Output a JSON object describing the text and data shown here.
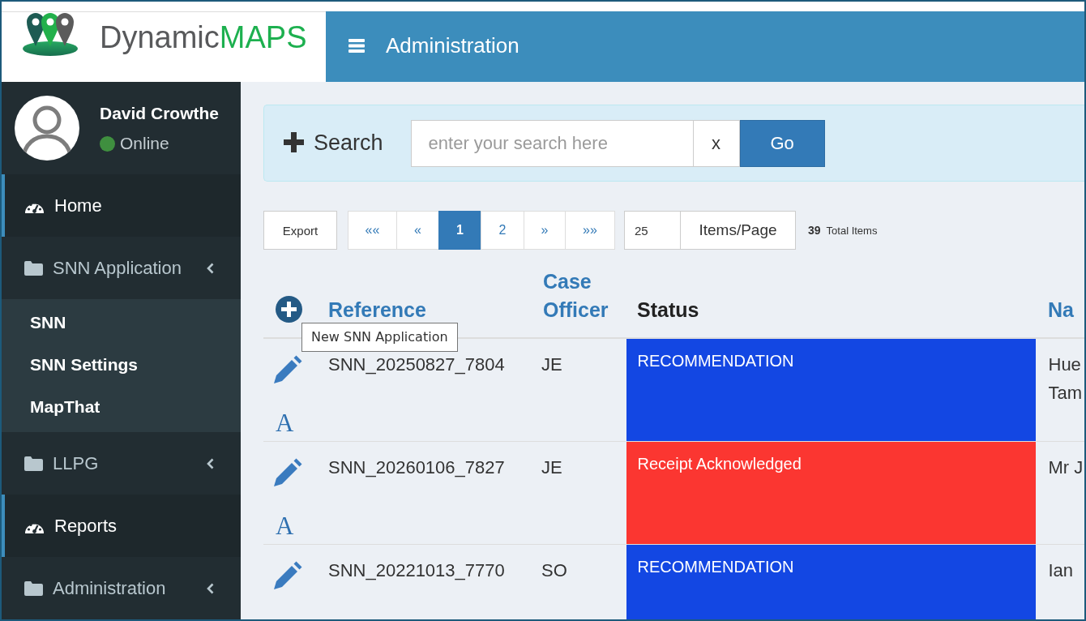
{
  "logo": {
    "prefix": "Dynamic",
    "suffix": "MAPS"
  },
  "header": {
    "title": "Administration"
  },
  "user": {
    "name": "David Crowthe",
    "status": "Online",
    "online": true
  },
  "sidebar": {
    "items": [
      {
        "kind": "link",
        "label": "Home",
        "selected": true
      },
      {
        "kind": "group",
        "label": "SNN Application",
        "selected": false,
        "expanded": true,
        "children": [
          {
            "label": "SNN"
          },
          {
            "label": "SNN Settings"
          },
          {
            "label": "MapThat"
          }
        ]
      },
      {
        "kind": "group",
        "label": "LLPG",
        "selected": false,
        "expanded": false
      },
      {
        "kind": "link",
        "label": "Reports",
        "selected": true
      },
      {
        "kind": "group",
        "label": "Administration",
        "selected": false,
        "expanded": false
      }
    ]
  },
  "search": {
    "label": "Search",
    "placeholder": "enter your search here",
    "clear": "x",
    "submit": "Go"
  },
  "toolbar": {
    "export": "Export",
    "pages": [
      {
        "label": "««",
        "selected": false
      },
      {
        "label": "«",
        "selected": false
      },
      {
        "label": "1",
        "selected": true
      },
      {
        "label": "2",
        "selected": false
      },
      {
        "label": "»",
        "selected": false
      },
      {
        "label": "»»",
        "selected": false
      }
    ],
    "page_size": "25",
    "page_size_button": "Items/Page",
    "total": "39",
    "total_label": "Total Items"
  },
  "table": {
    "add_tooltip": "New SNN Application",
    "columns": [
      {
        "label": "Reference",
        "link": true
      },
      {
        "label": "Case Officer",
        "link": true
      },
      {
        "label": "Status",
        "link": false
      },
      {
        "label": "Na",
        "link": true
      }
    ],
    "rows": [
      {
        "reference": "SNN_20250827_7804",
        "officer": "JE",
        "status": "RECOMMENDATION",
        "color": "#1347e3",
        "name": "Hue Tam",
        "letter": "A"
      },
      {
        "reference": "SNN_20260106_7827",
        "officer": "JE",
        "status": "Receipt Acknowledged",
        "color": "#fb3631",
        "name": "Mr J",
        "letter": "A"
      },
      {
        "reference": "SNN_20221013_7770",
        "officer": "SO",
        "status": "RECOMMENDATION",
        "color": "#1347e3",
        "name": "Ian"
      }
    ]
  }
}
